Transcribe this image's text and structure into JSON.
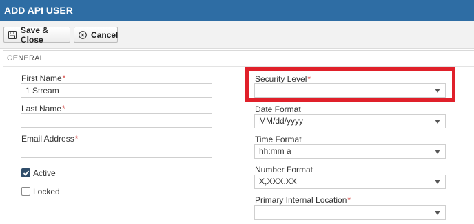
{
  "window": {
    "title": "ADD API USER"
  },
  "toolbar": {
    "save_label": "Save & Close",
    "cancel_label": "Cancel"
  },
  "section": {
    "title": "GENERAL"
  },
  "required_marker": "*",
  "left_fields": {
    "first_name": {
      "label": "First Name",
      "value": "1 Stream"
    },
    "last_name": {
      "label": "Last Name",
      "value": ""
    },
    "email": {
      "label": "Email Address",
      "value": ""
    }
  },
  "checkboxes": {
    "active": {
      "label": "Active",
      "checked": true
    },
    "locked": {
      "label": "Locked",
      "checked": false
    }
  },
  "right_fields": {
    "security_level": {
      "label": "Security Level",
      "value": ""
    },
    "date_format": {
      "label": "Date Format",
      "value": "MM/dd/yyyy"
    },
    "time_format": {
      "label": "Time Format",
      "value": "hh:mm a"
    },
    "number_format": {
      "label": "Number Format",
      "value": "X,XXX.XX"
    },
    "primary_location": {
      "label": "Primary Internal Location",
      "value": ""
    }
  },
  "colors": {
    "titlebar": "#2e6da4",
    "highlight": "#e0202a",
    "required": "#d9534f",
    "checkbox_checked": "#2f4d6a"
  },
  "icons": {
    "save": "floppy-disk-icon",
    "cancel": "circle-x-icon",
    "dropdown": "caret-down-icon",
    "check": "checkmark-icon"
  }
}
